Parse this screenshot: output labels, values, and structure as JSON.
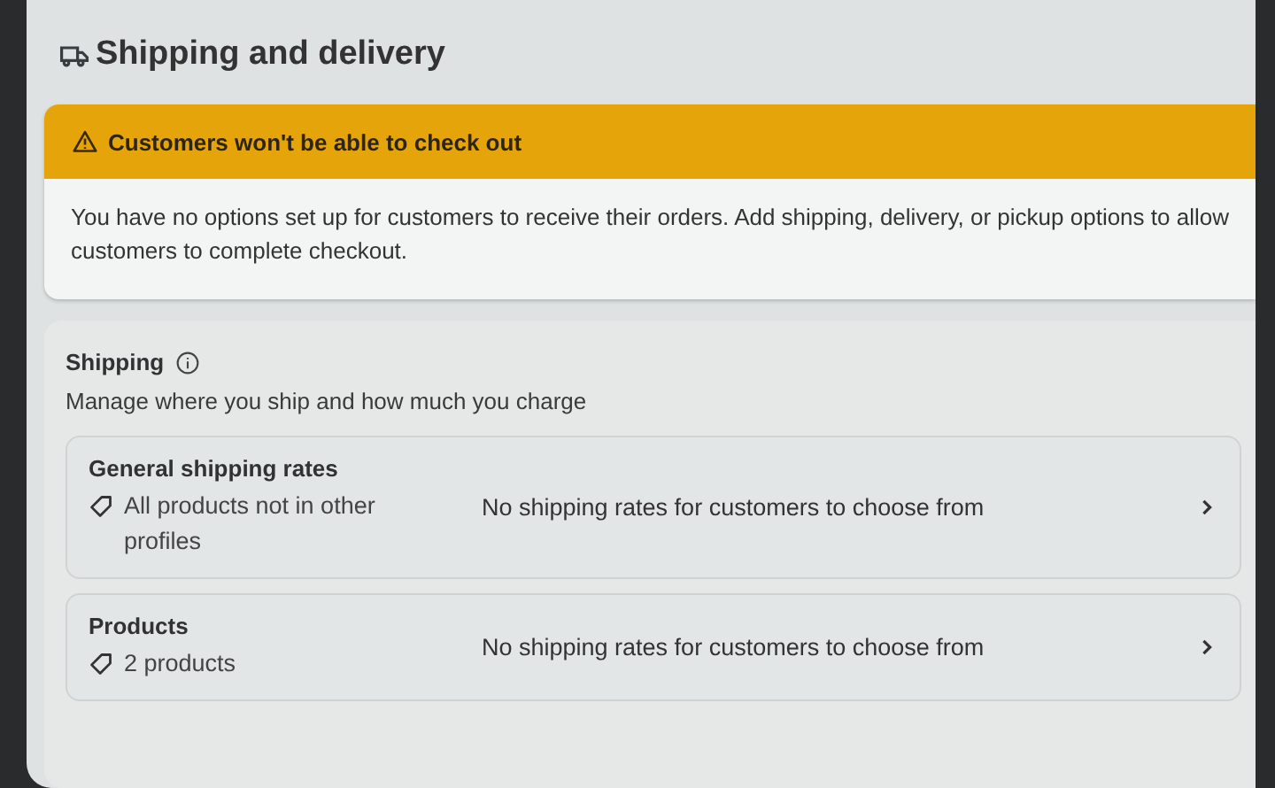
{
  "page": {
    "title": "Shipping and delivery"
  },
  "banner": {
    "title": "Customers won't be able to check out",
    "message": "You have no options set up for customers to receive their orders. Add shipping, delivery, or pickup options to allow customers to complete checkout."
  },
  "shipping": {
    "title": "Shipping",
    "description": "Manage where you ship and how much you charge",
    "profiles": [
      {
        "name": "General shipping rates",
        "scope": "All products not in other profiles",
        "rates": "No shipping rates for customers to choose from"
      },
      {
        "name": "Products",
        "scope": "2 products",
        "rates": "No shipping rates for customers to choose from"
      }
    ]
  }
}
